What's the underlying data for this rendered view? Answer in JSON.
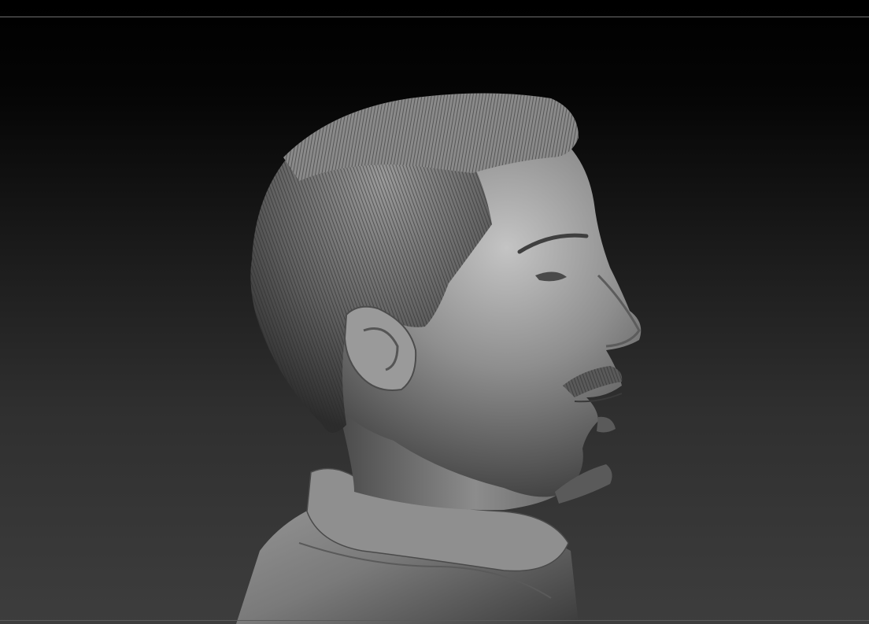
{
  "viewport": {
    "background_top": "#000000",
    "background_bottom": "#3d3d3d",
    "rule_color": "#6e6e6e"
  },
  "model": {
    "subject": "sculpted-male-bust-profile",
    "material_color": "#8a8a8a",
    "highlight_color": "#c9c9c9",
    "shadow_color": "#2a2a2a"
  }
}
